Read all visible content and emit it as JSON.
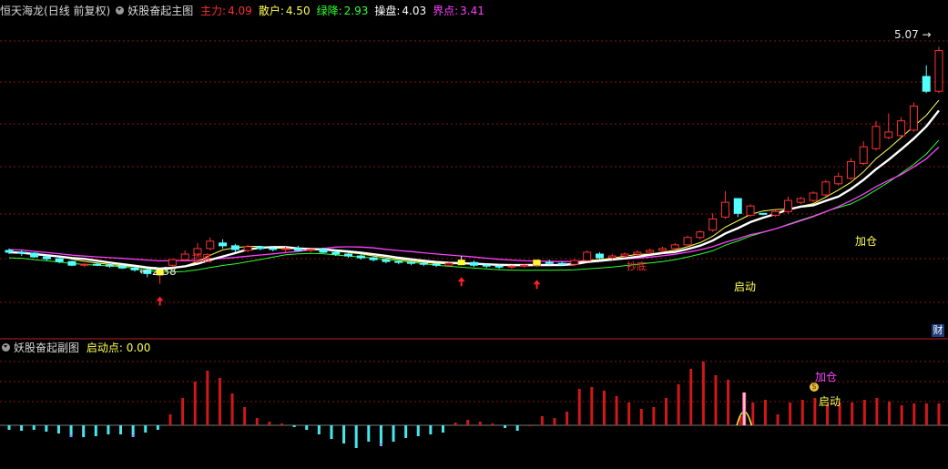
{
  "header": {
    "stock_name": "恒天海龙",
    "period": "(日线 前复权)",
    "indicator_name": "妖股奋起主图",
    "values": [
      {
        "label": "主力:",
        "value": "4.09",
        "color": "#ff3030"
      },
      {
        "label": "散户:",
        "value": "4.50",
        "color": "#ffff50"
      },
      {
        "label": "绿降:",
        "value": "2.93",
        "color": "#30ff30"
      },
      {
        "label": "操盘:",
        "value": "4.03",
        "color": "#ffffff"
      },
      {
        "label": "界点:",
        "value": "3.41",
        "color": "#ff40ff"
      }
    ]
  },
  "sub_header": {
    "indicator_name": "妖股奋起副图",
    "label": "启动点:",
    "value": "0.00"
  },
  "annotations": {
    "max_price": "5.07",
    "min_price": "2.38",
    "start_label": "启动",
    "add_label": "加仓",
    "bottom_label": "抄底",
    "sub_add_label": "加仓",
    "sub_start_label": "启动",
    "coin_icon": "$"
  },
  "side_tab": "财",
  "colors": {
    "background": "#000000",
    "grid": "#8a1515",
    "up": "#ff3232",
    "down": "#54ffff",
    "flat": "#ffffff",
    "ma_white": "#ffffff",
    "ma_yellow": "#ffff50",
    "ma_magenta": "#ff40ff",
    "ma_green": "#30ff30",
    "bar_up": "#d01818",
    "bar_down": "#44e8ee"
  },
  "chart_data": {
    "type": "candlestick",
    "price_range": [
      2.1,
      5.2
    ],
    "candles": [
      {
        "o": 2.74,
        "h": 2.76,
        "l": 2.7,
        "c": 2.72
      },
      {
        "o": 2.72,
        "h": 2.74,
        "l": 2.68,
        "c": 2.71
      },
      {
        "o": 2.71,
        "h": 2.72,
        "l": 2.66,
        "c": 2.67
      },
      {
        "o": 2.67,
        "h": 2.69,
        "l": 2.63,
        "c": 2.65
      },
      {
        "o": 2.65,
        "h": 2.66,
        "l": 2.6,
        "c": 2.62
      },
      {
        "o": 2.62,
        "h": 2.63,
        "l": 2.57,
        "c": 2.58
      },
      {
        "o": 2.58,
        "h": 2.6,
        "l": 2.56,
        "c": 2.59
      },
      {
        "o": 2.59,
        "h": 2.61,
        "l": 2.57,
        "c": 2.58
      },
      {
        "o": 2.58,
        "h": 2.59,
        "l": 2.55,
        "c": 2.57
      },
      {
        "o": 2.57,
        "h": 2.58,
        "l": 2.54,
        "c": 2.55
      },
      {
        "o": 2.55,
        "h": 2.57,
        "l": 2.51,
        "c": 2.53
      },
      {
        "o": 2.53,
        "h": 2.54,
        "l": 2.45,
        "c": 2.49
      },
      {
        "o": 2.49,
        "h": 2.52,
        "l": 2.38,
        "c": 2.5
      },
      {
        "o": 2.58,
        "h": 2.65,
        "l": 2.56,
        "c": 2.64
      },
      {
        "o": 2.64,
        "h": 2.74,
        "l": 2.62,
        "c": 2.7
      },
      {
        "o": 2.7,
        "h": 2.82,
        "l": 2.68,
        "c": 2.76
      },
      {
        "o": 2.76,
        "h": 2.88,
        "l": 2.74,
        "c": 2.84
      },
      {
        "o": 2.82,
        "h": 2.86,
        "l": 2.76,
        "c": 2.79
      },
      {
        "o": 2.79,
        "h": 2.81,
        "l": 2.72,
        "c": 2.75
      },
      {
        "o": 2.74,
        "h": 2.8,
        "l": 2.72,
        "c": 2.78
      },
      {
        "o": 2.78,
        "h": 2.79,
        "l": 2.74,
        "c": 2.76
      },
      {
        "o": 2.76,
        "h": 2.78,
        "l": 2.73,
        "c": 2.75
      },
      {
        "o": 2.75,
        "h": 2.78,
        "l": 2.72,
        "c": 2.76
      },
      {
        "o": 2.76,
        "h": 2.79,
        "l": 2.73,
        "c": 2.74
      },
      {
        "o": 2.74,
        "h": 2.76,
        "l": 2.72,
        "c": 2.75
      },
      {
        "o": 2.75,
        "h": 2.77,
        "l": 2.71,
        "c": 2.72
      },
      {
        "o": 2.72,
        "h": 2.74,
        "l": 2.68,
        "c": 2.7
      },
      {
        "o": 2.7,
        "h": 2.71,
        "l": 2.66,
        "c": 2.68
      },
      {
        "o": 2.68,
        "h": 2.7,
        "l": 2.64,
        "c": 2.66
      },
      {
        "o": 2.66,
        "h": 2.67,
        "l": 2.62,
        "c": 2.64
      },
      {
        "o": 2.64,
        "h": 2.66,
        "l": 2.6,
        "c": 2.62
      },
      {
        "o": 2.62,
        "h": 2.63,
        "l": 2.59,
        "c": 2.61
      },
      {
        "o": 2.61,
        "h": 2.63,
        "l": 2.58,
        "c": 2.6
      },
      {
        "o": 2.6,
        "h": 2.62,
        "l": 2.57,
        "c": 2.59
      },
      {
        "o": 2.59,
        "h": 2.6,
        "l": 2.56,
        "c": 2.58
      },
      {
        "o": 2.58,
        "h": 2.61,
        "l": 2.56,
        "c": 2.6
      },
      {
        "o": 2.61,
        "h": 2.68,
        "l": 2.59,
        "c": 2.61
      },
      {
        "o": 2.61,
        "h": 2.63,
        "l": 2.56,
        "c": 2.58
      },
      {
        "o": 2.58,
        "h": 2.6,
        "l": 2.55,
        "c": 2.57
      },
      {
        "o": 2.57,
        "h": 2.59,
        "l": 2.54,
        "c": 2.56
      },
      {
        "o": 2.56,
        "h": 2.58,
        "l": 2.54,
        "c": 2.57
      },
      {
        "o": 2.57,
        "h": 2.59,
        "l": 2.55,
        "c": 2.58
      },
      {
        "o": 2.58,
        "h": 2.62,
        "l": 2.56,
        "c": 2.61
      },
      {
        "o": 2.61,
        "h": 2.64,
        "l": 2.58,
        "c": 2.6
      },
      {
        "o": 2.6,
        "h": 2.62,
        "l": 2.57,
        "c": 2.59
      },
      {
        "o": 2.59,
        "h": 2.65,
        "l": 2.57,
        "c": 2.63
      },
      {
        "o": 2.63,
        "h": 2.74,
        "l": 2.62,
        "c": 2.72
      },
      {
        "o": 2.7,
        "h": 2.72,
        "l": 2.64,
        "c": 2.66
      },
      {
        "o": 2.66,
        "h": 2.7,
        "l": 2.64,
        "c": 2.68
      },
      {
        "o": 2.68,
        "h": 2.72,
        "l": 2.66,
        "c": 2.7
      },
      {
        "o": 2.7,
        "h": 2.74,
        "l": 2.68,
        "c": 2.72
      },
      {
        "o": 2.72,
        "h": 2.76,
        "l": 2.7,
        "c": 2.74
      },
      {
        "o": 2.74,
        "h": 2.78,
        "l": 2.72,
        "c": 2.76
      },
      {
        "o": 2.76,
        "h": 2.82,
        "l": 2.74,
        "c": 2.8
      },
      {
        "o": 2.8,
        "h": 2.9,
        "l": 2.78,
        "c": 2.88
      },
      {
        "o": 2.88,
        "h": 2.96,
        "l": 2.86,
        "c": 2.94
      },
      {
        "o": 2.96,
        "h": 3.14,
        "l": 2.94,
        "c": 3.08
      },
      {
        "o": 3.1,
        "h": 3.38,
        "l": 3.08,
        "c": 3.26
      },
      {
        "o": 3.3,
        "h": 3.3,
        "l": 3.1,
        "c": 3.14
      },
      {
        "o": 3.12,
        "h": 3.24,
        "l": 3.1,
        "c": 3.22
      },
      {
        "o": 3.14,
        "h": 3.14,
        "l": 3.12,
        "c": 3.13
      },
      {
        "o": 3.12,
        "h": 3.18,
        "l": 3.1,
        "c": 3.16
      },
      {
        "o": 3.16,
        "h": 3.32,
        "l": 3.14,
        "c": 3.28
      },
      {
        "o": 3.26,
        "h": 3.32,
        "l": 3.24,
        "c": 3.3
      },
      {
        "o": 3.28,
        "h": 3.38,
        "l": 3.26,
        "c": 3.36
      },
      {
        "o": 3.34,
        "h": 3.5,
        "l": 3.32,
        "c": 3.48
      },
      {
        "o": 3.46,
        "h": 3.58,
        "l": 3.44,
        "c": 3.54
      },
      {
        "o": 3.52,
        "h": 3.74,
        "l": 3.5,
        "c": 3.7
      },
      {
        "o": 3.68,
        "h": 3.92,
        "l": 3.66,
        "c": 3.86
      },
      {
        "o": 3.84,
        "h": 4.14,
        "l": 3.82,
        "c": 4.08
      },
      {
        "o": 3.96,
        "h": 4.22,
        "l": 3.94,
        "c": 4.02
      },
      {
        "o": 3.98,
        "h": 4.18,
        "l": 3.96,
        "c": 4.14
      },
      {
        "o": 4.04,
        "h": 4.34,
        "l": 4.02,
        "c": 4.3
      },
      {
        "o": 4.62,
        "h": 4.74,
        "l": 4.44,
        "c": 4.46
      },
      {
        "o": 4.46,
        "h": 4.94,
        "l": 4.44,
        "c": 4.9
      }
    ],
    "sub_bars": [
      -0.05,
      -0.06,
      -0.05,
      -0.07,
      -0.09,
      -0.12,
      -0.13,
      -0.12,
      -0.1,
      -0.1,
      -0.12,
      -0.08,
      -0.05,
      0.12,
      0.3,
      0.48,
      0.6,
      0.52,
      0.35,
      0.2,
      0.08,
      0.04,
      0.02,
      -0.02,
      -0.05,
      -0.1,
      -0.15,
      -0.2,
      -0.25,
      -0.18,
      -0.22,
      -0.18,
      -0.14,
      -0.12,
      -0.1,
      -0.08,
      0.03,
      0.06,
      0.04,
      0.02,
      -0.03,
      -0.06,
      0.0,
      0.1,
      0.08,
      0.15,
      0.4,
      0.42,
      0.38,
      0.32,
      0.25,
      0.18,
      0.2,
      0.3,
      0.45,
      0.62,
      0.7,
      0.55,
      0.5,
      0.1,
      0.25,
      0.28,
      0.12,
      0.25,
      0.28,
      0.3,
      0.22,
      0.25,
      0.25,
      0.28,
      0.3,
      0.26,
      0.22,
      0.24,
      0.24,
      0.24
    ]
  }
}
